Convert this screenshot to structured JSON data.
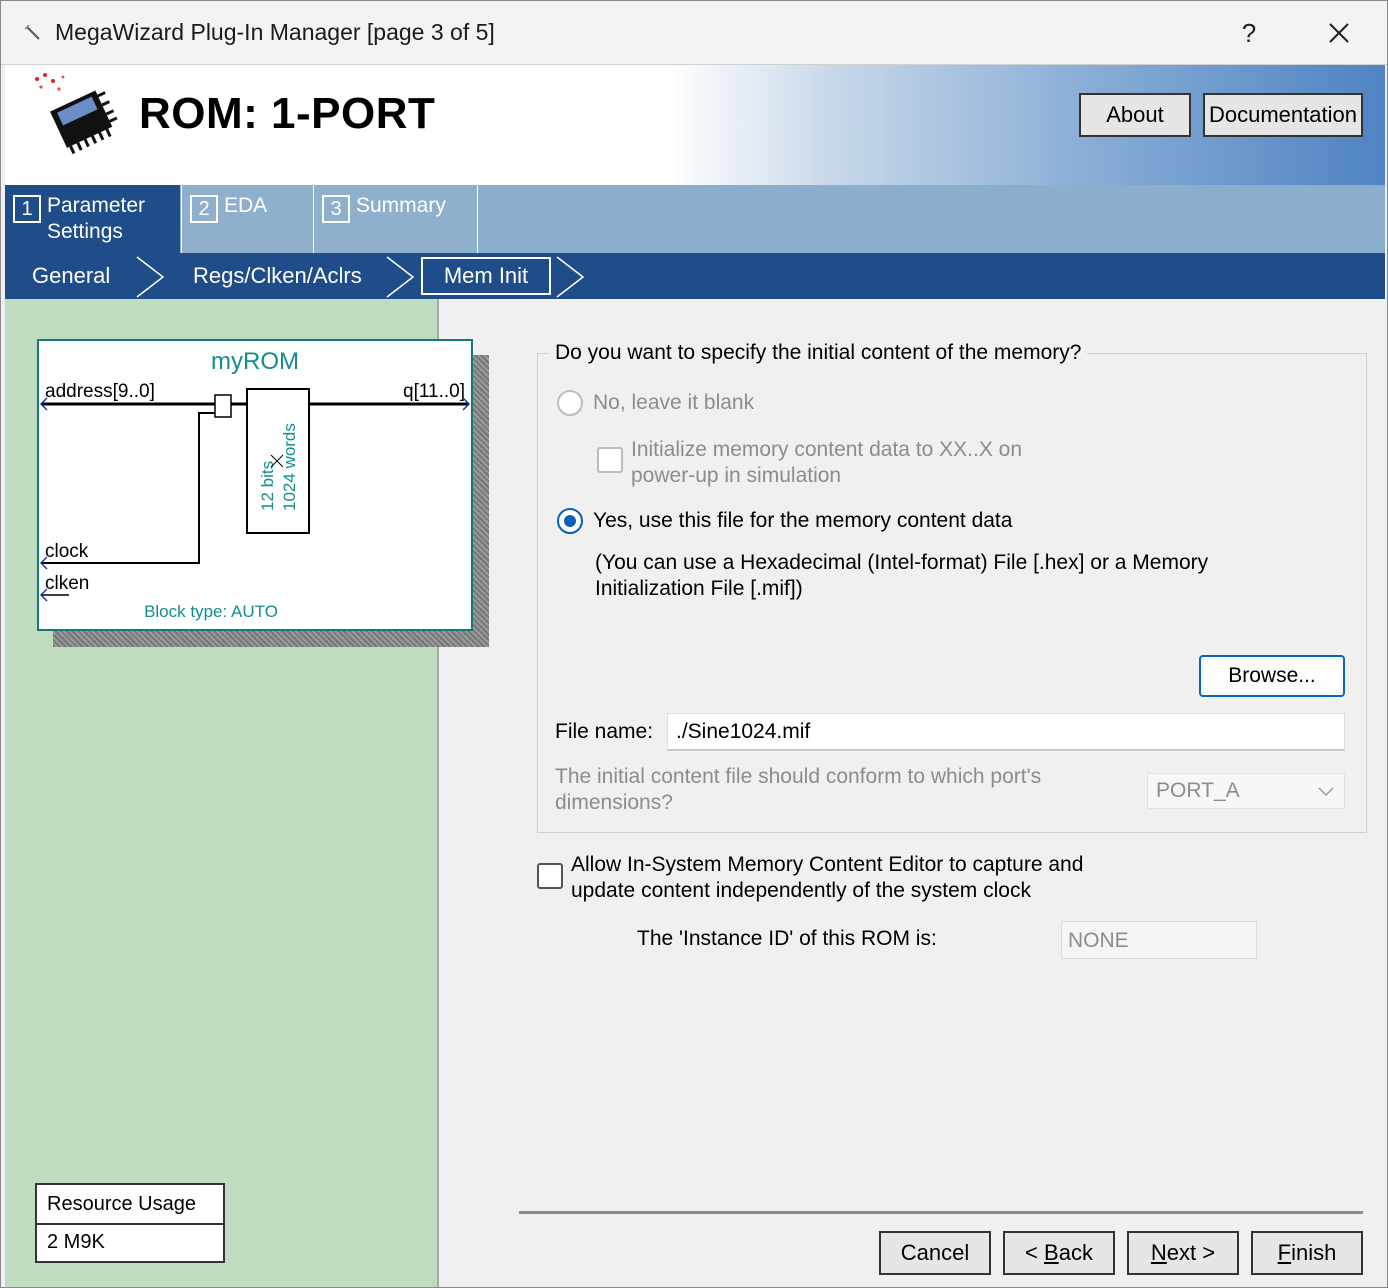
{
  "window": {
    "title": "MegaWizard Plug-In Manager [page 3 of 5]",
    "help_label": "?"
  },
  "header": {
    "title": "ROM: 1-PORT",
    "about_label": "About",
    "documentation_label": "Documentation"
  },
  "tabs": [
    {
      "number": "1",
      "label_line1": "Parameter",
      "label_line2": "Settings",
      "active": true
    },
    {
      "number": "2",
      "label_line1": "EDA",
      "label_line2": "",
      "active": false
    },
    {
      "number": "3",
      "label_line1": "Summary",
      "label_line2": "",
      "active": false
    }
  ],
  "subnav": {
    "items": [
      "General",
      "Regs/Clken/Aclrs",
      "Mem Init"
    ],
    "active": "Mem Init"
  },
  "symbol": {
    "name": "myROM",
    "input_address": "address[9..0]",
    "output_q": "q[11..0]",
    "input_clock": "clock",
    "input_clken": "clken",
    "memory_bits": "12 bits",
    "memory_words": "1024 words",
    "block_type": "Block type: AUTO"
  },
  "resource_usage": {
    "header": "Resource Usage",
    "value": "2 M9K"
  },
  "mem_init": {
    "question": "Do you want to specify the initial content of the memory?",
    "option_no": "No, leave it blank",
    "option_no_selected": false,
    "init_xx_line1": "Initialize memory content data to XX..X on",
    "init_xx_line2": "power-up in simulation",
    "init_xx_checked": false,
    "option_yes": "Yes, use this file for the memory content data",
    "option_yes_selected": true,
    "hint_line1": "(You can use a Hexadecimal (Intel-format) File [.hex] or a Memory",
    "hint_line2": "Initialization File [.mif])",
    "browse_label": "Browse...",
    "file_name_label": "File name:",
    "file_name_value": "./Sine1024.mif",
    "port_question_line1": "The initial content file should conform to which port's",
    "port_question_line2": "dimensions?",
    "port_value": "PORT_A"
  },
  "isme": {
    "label_line1": "Allow In-System Memory Content Editor to capture and",
    "label_line2": "update content independently of the system clock",
    "checked": false,
    "instance_id_label": "The 'Instance ID' of this ROM is:",
    "instance_id_value": "NONE"
  },
  "footer": {
    "cancel_label": "Cancel",
    "back_prefix": "< ",
    "back_mnemonic": "B",
    "back_rest": "ack",
    "next_mnemonic": "N",
    "next_rest": "ext >",
    "finish_mnemonic": "F",
    "finish_rest": "inish"
  },
  "colors": {
    "accent": "#0a5fb8",
    "nav_bar": "#1f4d8a",
    "tab_inactive": "#8fb0cd",
    "left_panel": "#c0dcc0",
    "symbol_teal": "#167878"
  }
}
